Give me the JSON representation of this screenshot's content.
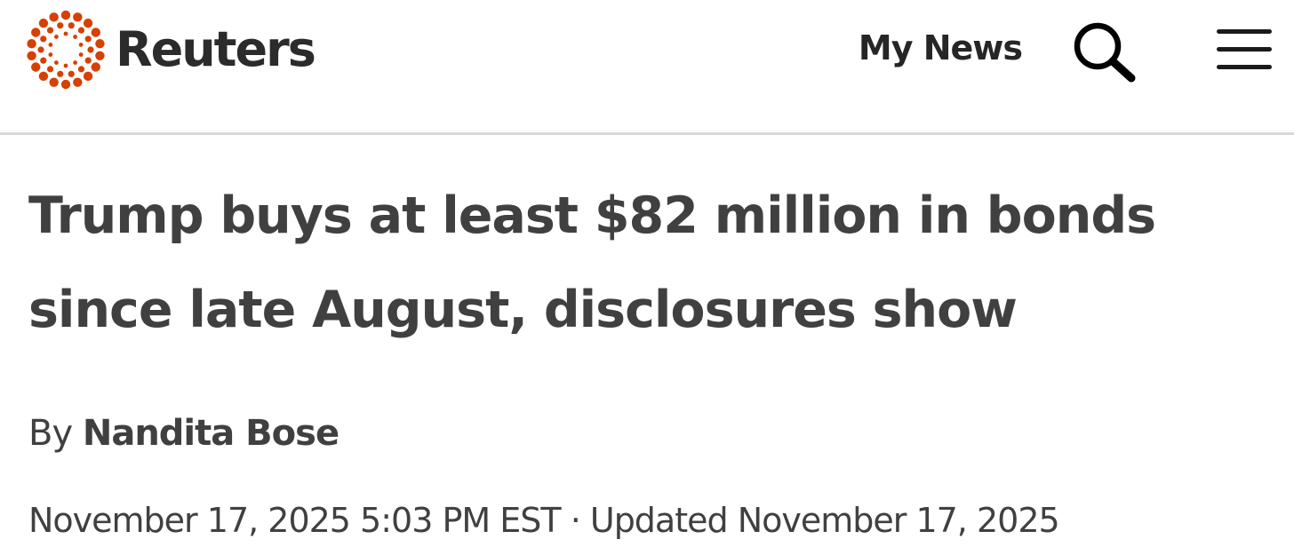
{
  "header": {
    "brand": {
      "name": "Reuters",
      "logo_icon": "reuters-dot-ring-logo",
      "accent_color": "#d64000"
    },
    "my_news_label": "My News",
    "search_icon": "search-icon",
    "menu_icon": "hamburger-menu-icon"
  },
  "article": {
    "headline": "Trump buys at least $82 million in bonds since late August, disclosures show",
    "byline": {
      "prefix": "By",
      "author": "Nandita Bose"
    },
    "published": "November 17, 2025 5:03 PM EST",
    "separator": "·",
    "updated": "Updated November 17, 2025"
  },
  "colors": {
    "text": "#404040",
    "divider": "#d9d9d9",
    "background": "#ffffff"
  }
}
